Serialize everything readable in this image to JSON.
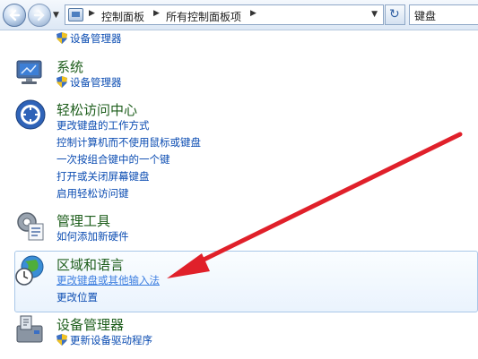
{
  "breadcrumb": [
    "控制面板",
    "所有控制面板项"
  ],
  "search": {
    "value": "键盘"
  },
  "categories": [
    {
      "links": [
        {
          "label": "设备管理器",
          "shield": true
        }
      ]
    },
    {
      "title": "系统",
      "links": [
        {
          "label": "设备管理器",
          "shield": true
        }
      ]
    },
    {
      "title": "轻松访问中心",
      "links": [
        {
          "label": "更改键盘的工作方式"
        },
        {
          "label": "控制计算机而不使用鼠标或键盘"
        },
        {
          "label": "一次按组合键中的一个键"
        },
        {
          "label": "打开或关闭屏幕键盘"
        },
        {
          "label": "启用轻松访问键"
        }
      ]
    },
    {
      "title": "管理工具",
      "links": [
        {
          "label": "如何添加新硬件"
        }
      ]
    },
    {
      "title": "区域和语言",
      "links": [
        {
          "label": "更改键盘或其他输入法"
        },
        {
          "label": "更改位置"
        }
      ]
    },
    {
      "title": "设备管理器",
      "links": [
        {
          "label": "更新设备驱动程序",
          "shield": true
        }
      ]
    }
  ],
  "colors": {
    "title": "#1e5e1c",
    "link": "#0b4cb2",
    "arrow": "#e0202a",
    "highlight_border": "#a9c7e8"
  },
  "icons": {
    "back": "back-arrow-icon",
    "forward": "forward-arrow-icon",
    "control_panel": "control-panel-icon",
    "refresh": "refresh-icon",
    "shield": "uac-shield-icon",
    "system": "system-monitor-icon",
    "ease_of_access": "ease-of-access-icon",
    "admin_tools": "admin-tools-icon",
    "region": "globe-clock-icon",
    "device_manager": "device-manager-icon"
  }
}
